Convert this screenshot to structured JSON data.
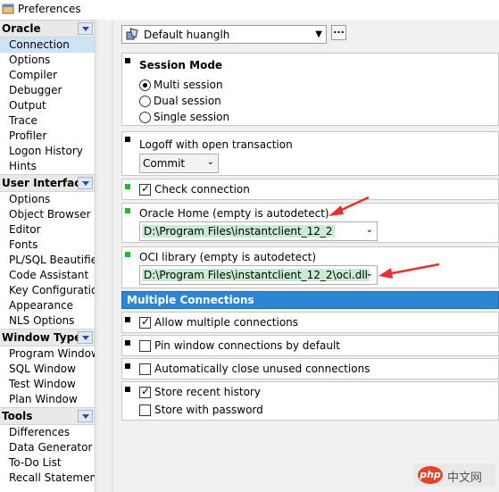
{
  "window": {
    "title": "Preferences"
  },
  "sidebar": {
    "groups": [
      {
        "label": "Oracle",
        "items": [
          "Connection",
          "Options",
          "Compiler",
          "Debugger",
          "Output",
          "Trace",
          "Profiler",
          "Logon History",
          "Hints"
        ],
        "selected": "Connection"
      },
      {
        "label": "User Interface",
        "items": [
          "Options",
          "Object Browser",
          "Editor",
          "Fonts",
          "PL/SQL Beautifier",
          "Code Assistant",
          "Key Configuration",
          "Appearance",
          "NLS Options"
        ]
      },
      {
        "label": "Window Types",
        "items": [
          "Program Window",
          "SQL Window",
          "Test Window",
          "Plan Window"
        ]
      },
      {
        "label": "Tools",
        "items": [
          "Differences",
          "Data Generator",
          "To-Do List",
          "Recall Statement"
        ]
      }
    ]
  },
  "profile": {
    "value": "Default huanglh",
    "more_label": "..."
  },
  "session_mode": {
    "title": "Session Mode",
    "options": [
      "Multi session",
      "Dual session",
      "Single session"
    ],
    "selected": "Multi session"
  },
  "logoff": {
    "label": "Logoff with open transaction",
    "value": "Commit"
  },
  "check_connection": {
    "label": "Check connection",
    "checked": true
  },
  "oracle_home": {
    "label": "Oracle Home (empty is autodetect)",
    "value": "D:\\Program Files\\instantclient_12_2"
  },
  "oci_library": {
    "label": "OCI library (empty is autodetect)",
    "value": "D:\\Program Files\\instantclient_12_2\\oci.dll"
  },
  "multiple_connections": {
    "header": "Multiple Connections",
    "allow": {
      "label": "Allow multiple connections",
      "checked": true
    },
    "pin": {
      "label": "Pin window connections by default",
      "checked": false
    },
    "auto_close": {
      "label": "Automatically close unused connections",
      "checked": false
    },
    "store_history": {
      "label": "Store recent history",
      "checked": true
    },
    "store_password": {
      "label": "Store with password",
      "checked": false
    }
  },
  "watermark": {
    "logo": "php",
    "text": "中文网"
  },
  "colors": {
    "accent": "#2e85d3",
    "marker_green": "#19c02c",
    "field_green": "#c9ebd2",
    "arrow_red": "#e8312f"
  }
}
